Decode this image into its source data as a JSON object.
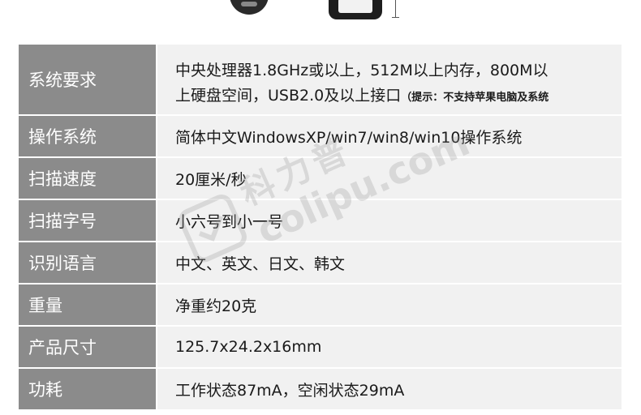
{
  "specs": [
    {
      "label": "系统要求",
      "value_line1": "中央处理器1.8GHz或以上，512M以上内存，800M以",
      "value_line2": "上硬盘空间，USB2.0及以上接口",
      "value_note": "（提示：不支持苹果电脑及系统"
    },
    {
      "label": "操作系统",
      "value": "简体中文WindowsXP/win7/win8/win10操作系统"
    },
    {
      "label": "扫描速度",
      "value": "20厘米/秒"
    },
    {
      "label": "扫描字号",
      "value": "小六号到小一号"
    },
    {
      "label": "识别语言",
      "value": "中文、英文、日文、韩文"
    },
    {
      "label": "重量",
      "value": "净重约20克"
    },
    {
      "label": "产品尺寸",
      "value": "125.7x24.2x16mm"
    },
    {
      "label": "功耗",
      "value": "工作状态87mA，空闲状态29mA"
    }
  ],
  "watermark": {
    "brand_cn": "科力普",
    "url": "colipu.com"
  },
  "colors": {
    "label_bg": "#8b8b8b",
    "value_bg": "#f1f1f1",
    "label_text": "#ffffff",
    "value_text": "#1a1a1a"
  }
}
